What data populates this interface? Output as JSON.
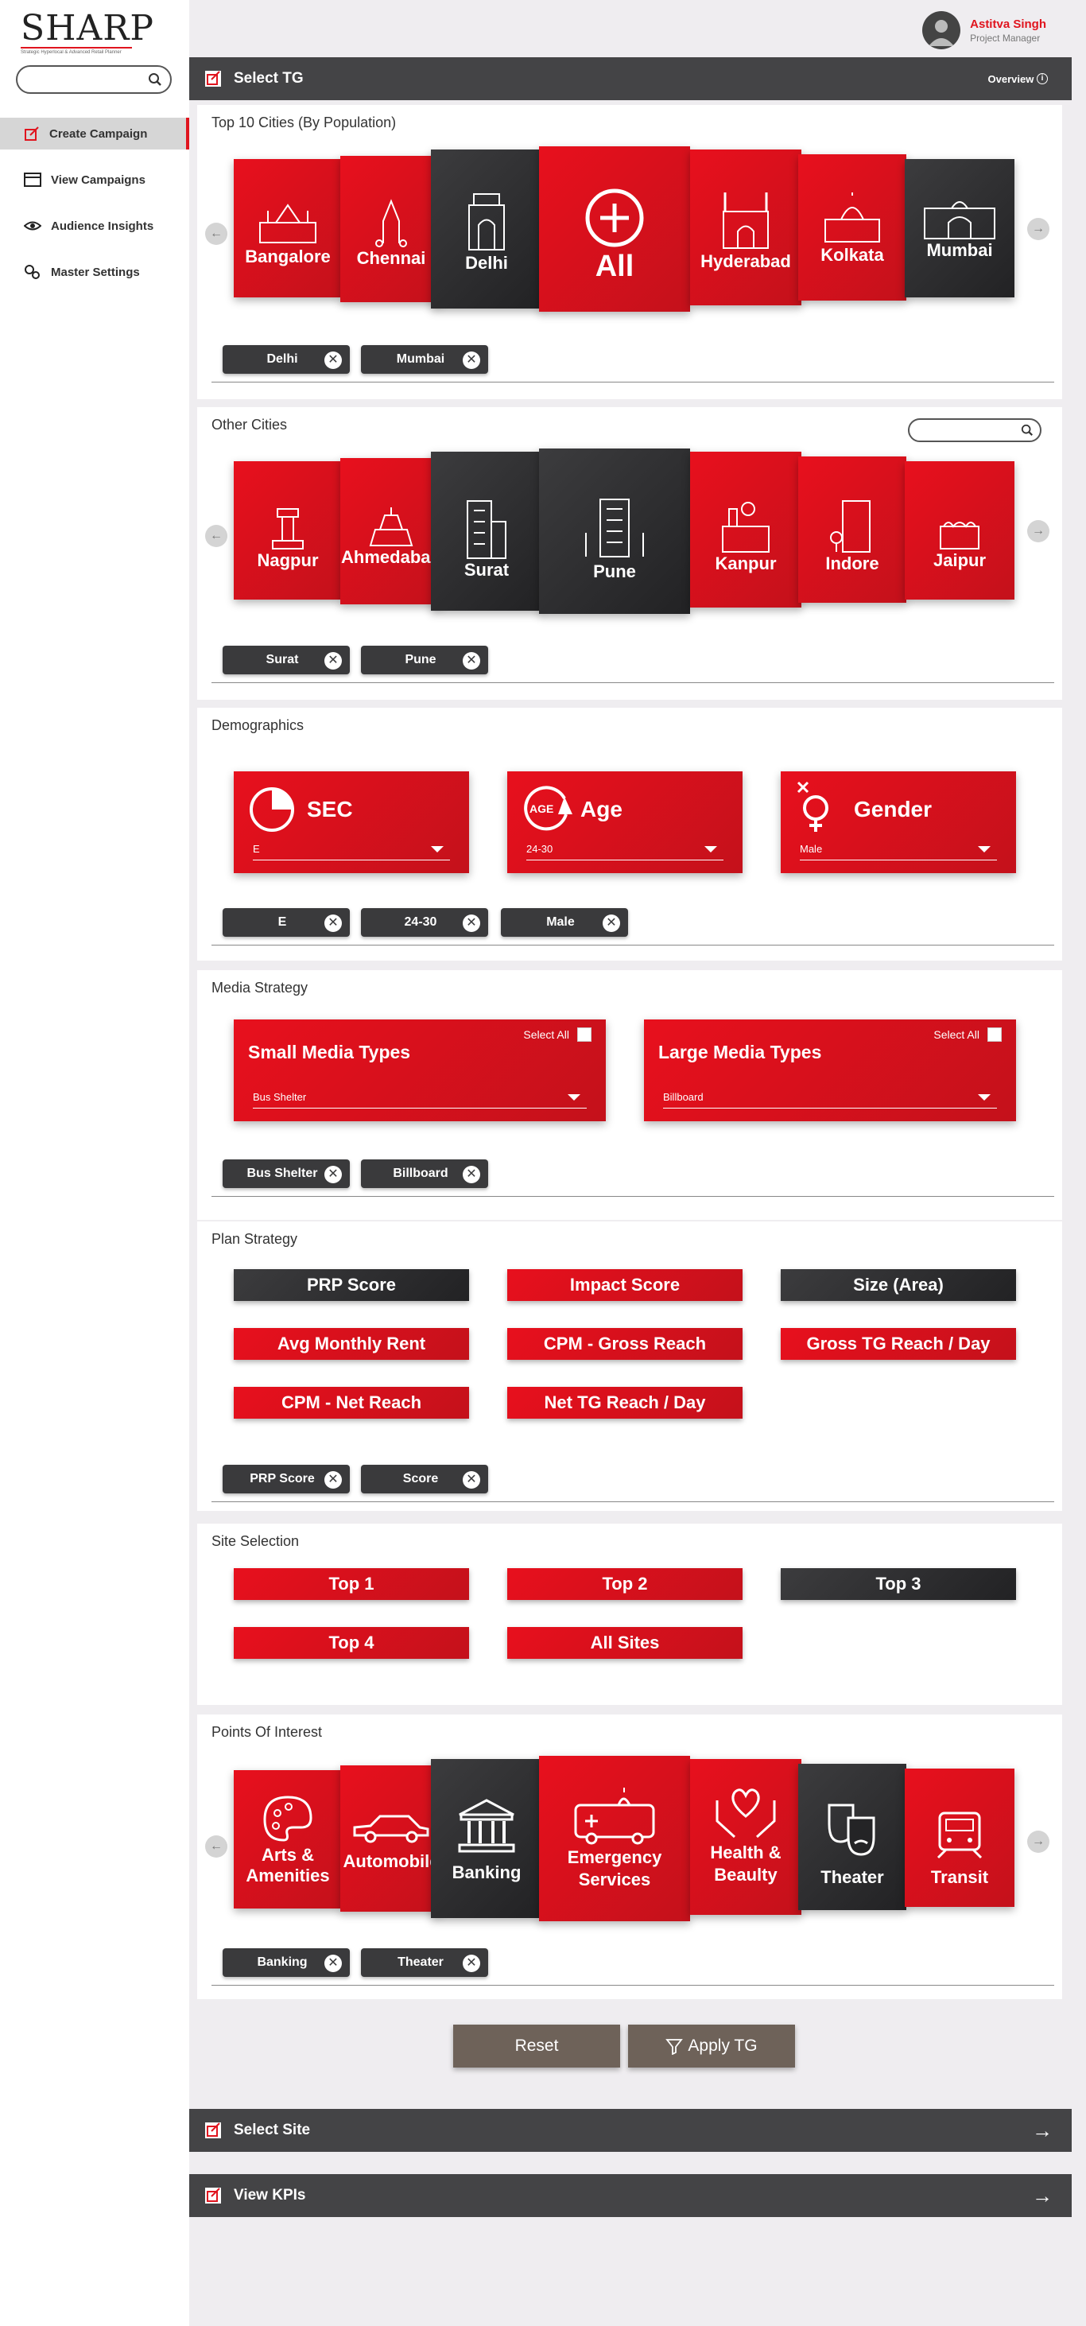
{
  "brand": {
    "logo": "SHARP",
    "tagline": "Strategic Hyperlocal & Advanced Retail Planner"
  },
  "user": {
    "name": "Astitva Singh",
    "role": "Project Manager"
  },
  "sidebar": {
    "items": [
      {
        "label": "Create Campaign",
        "icon": "campaign-icon",
        "active": true
      },
      {
        "label": "View Campaigns",
        "icon": "window-icon"
      },
      {
        "label": "Audience Insights",
        "icon": "eye-icon"
      },
      {
        "label": "Master Settings",
        "icon": "gears-icon"
      }
    ]
  },
  "select_tg": {
    "title": "Select TG",
    "overview": "Overview"
  },
  "top_cities": {
    "title": "Top 10 Cities (By Population)",
    "cards": [
      "Bangalore",
      "Chennai",
      "Delhi",
      "All",
      "Hyderabad",
      "Kolkata",
      "Mumbai"
    ],
    "chips": [
      "Delhi",
      "Mumbai"
    ]
  },
  "other_cities": {
    "title": "Other Cities",
    "cards": [
      "Nagpur",
      "Ahmedabad",
      "Surat",
      "Pune",
      "Kanpur",
      "Indore",
      "Jaipur"
    ],
    "chips": [
      "Surat",
      "Pune"
    ]
  },
  "demographics": {
    "title": "Demographics",
    "cards": [
      {
        "label": "SEC",
        "value": "E",
        "icon": "pie-icon"
      },
      {
        "label": "Age",
        "value": "24-30",
        "icon": "age-icon"
      },
      {
        "label": "Gender",
        "value": "Male",
        "icon": "gender-icon"
      }
    ],
    "chips": [
      "E",
      "24-30",
      "Male"
    ]
  },
  "media_strategy": {
    "title": "Media Strategy",
    "select_all": "Select All",
    "cards": [
      {
        "label": "Small Media Types",
        "value": "Bus Shelter"
      },
      {
        "label": "Large Media Types",
        "value": "Billboard"
      }
    ],
    "chips": [
      "Bus Shelter",
      "Billboard"
    ]
  },
  "plan_strategy": {
    "title": "Plan Strategy",
    "buttons": [
      "PRP Score",
      "Impact Score",
      "Size (Area)",
      "Avg Monthly Rent",
      "CPM - Gross Reach",
      "Gross TG Reach / Day",
      "CPM - Net Reach",
      "Net TG Reach / Day"
    ],
    "chips": [
      "PRP Score",
      "Score"
    ]
  },
  "site_selection": {
    "title": "Site Selection",
    "buttons": [
      "Top 1",
      "Top 2",
      "Top 3",
      "Top 4",
      "All Sites"
    ]
  },
  "poi": {
    "title": "Points Of Interest",
    "cards": [
      "Arts & Amenities",
      "Automobile",
      "Banking",
      "Emergency Services",
      "Health & Beaulty",
      "Theater",
      "Transit"
    ],
    "chips": [
      "Banking",
      "Theater"
    ]
  },
  "actions": {
    "reset": "Reset",
    "apply": "Apply TG"
  },
  "select_site": {
    "title": "Select Site"
  },
  "view_kpis": {
    "title": "View KPIs"
  },
  "colors": {
    "accent": "#e0141e",
    "dark": "#3a3a3c",
    "bar": "#444446",
    "action": "#6e6259"
  }
}
